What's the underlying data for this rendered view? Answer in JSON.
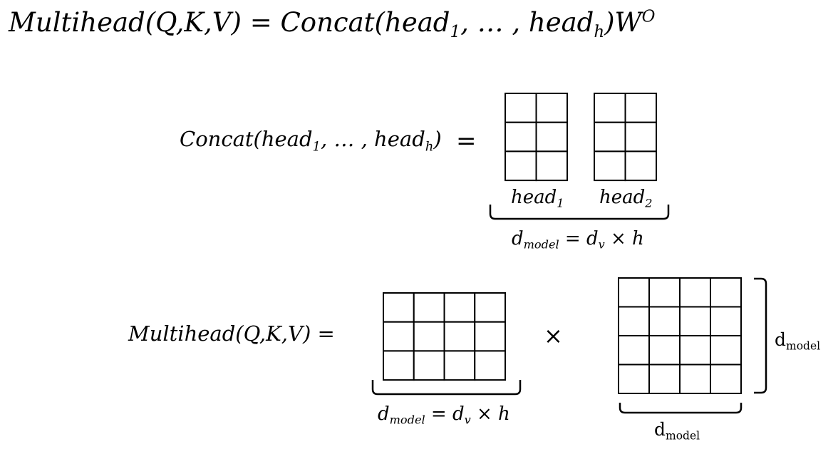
{
  "top_equation": {
    "lhs": "Multihead(Q,K,V) = Concat(head",
    "sub1": "1",
    "mid": ", … , head",
    "subh": "h",
    "tail": ")W",
    "sup": "O"
  },
  "concat_equation": {
    "lhs": "Concat(head",
    "sub1": "1",
    "mid": ", … , head",
    "subh": "h",
    "tail": ")",
    "equals": "="
  },
  "head_labels": [
    {
      "base": "head",
      "sub": "1"
    },
    {
      "base": "head",
      "sub": "2"
    }
  ],
  "concat_dim_label": {
    "d": "d",
    "dsub": "model",
    "rest": " = d",
    "vsub": "v",
    "tail": " × h"
  },
  "multi_equation": {
    "text": "Multihead(Q,K,V) ="
  },
  "times_symbol": "×",
  "left_matrix_dim_label": {
    "d": "d",
    "dsub": "model",
    "rest": " = d",
    "vsub": "v",
    "tail": " × h"
  },
  "w_matrix_right_label": {
    "d": "d",
    "dsub": "model"
  },
  "w_matrix_bottom_label": {
    "d": "d",
    "dsub": "model"
  },
  "matrices": {
    "head1": {
      "rows": 3,
      "cols": 2
    },
    "head2": {
      "rows": 3,
      "cols": 2
    },
    "concat_result": {
      "rows": 3,
      "cols": 4
    },
    "w_o": {
      "rows": 4,
      "cols": 4
    }
  }
}
